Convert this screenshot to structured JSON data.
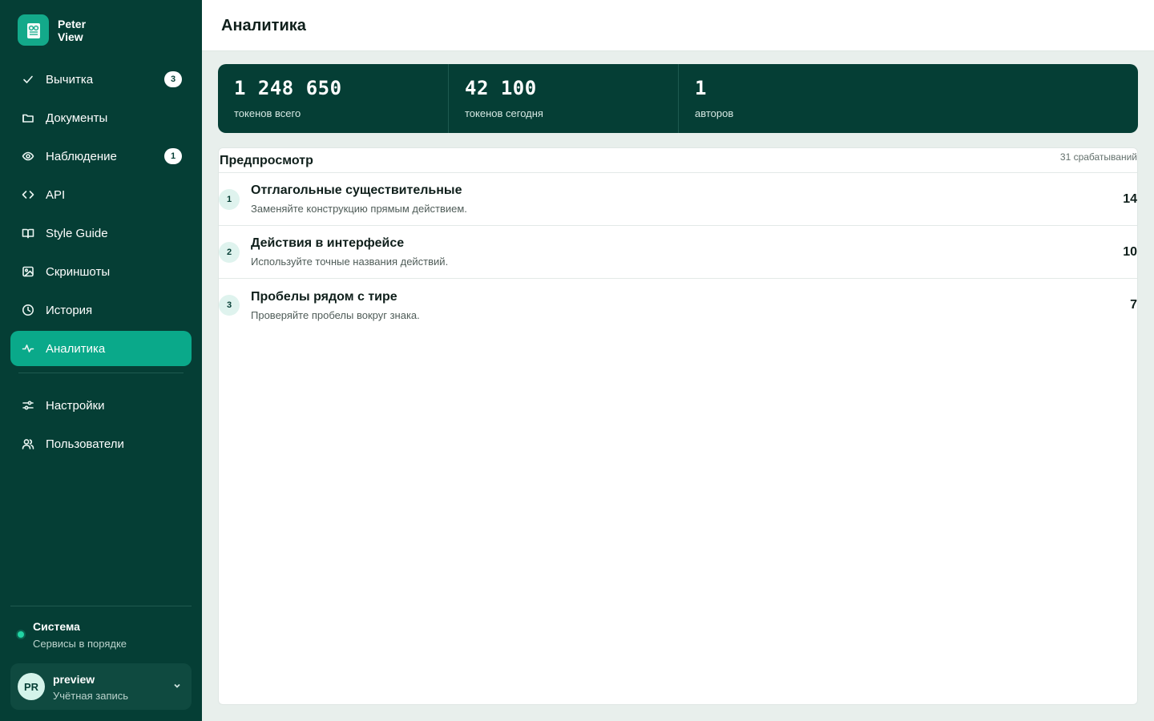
{
  "brand": {
    "line1": "Peter",
    "line2": "View",
    "icon": "book-reader-icon"
  },
  "sidebar": {
    "items": [
      {
        "label": "Вычитка",
        "icon": "check-icon",
        "badge": "3"
      },
      {
        "label": "Документы",
        "icon": "folder-icon"
      },
      {
        "label": "Наблюдение",
        "icon": "eye-icon",
        "badge": "1"
      },
      {
        "label": "API",
        "icon": "code-icon"
      },
      {
        "label": "Style Guide",
        "icon": "book-icon"
      },
      {
        "label": "Скриншоты",
        "icon": "image-icon"
      },
      {
        "label": "История",
        "icon": "clock-icon"
      },
      {
        "label": "Аналитика",
        "icon": "activity-icon",
        "active": true
      }
    ],
    "secondary": [
      {
        "label": "Настройки",
        "icon": "sliders-icon"
      },
      {
        "label": "Пользователи",
        "icon": "users-icon"
      }
    ]
  },
  "system": {
    "title": "Система",
    "status": "Сервисы в порядке",
    "status_color": "#21d4a4"
  },
  "account": {
    "initials": "PR",
    "name": "preview",
    "sub": "Учётная запись"
  },
  "header": {
    "title": "Аналитика"
  },
  "stats": [
    {
      "value": "1 248 650",
      "label": "токенов всего"
    },
    {
      "value": "42 100",
      "label": "токенов сегодня"
    },
    {
      "value": "1",
      "label": "авторов"
    }
  ],
  "preview": {
    "title": "Предпросмотр",
    "meta": "31 срабатываний",
    "rows": [
      {
        "rank": "1",
        "title": "Отглагольные существительные",
        "sub": "Заменяйте конструкцию прямым действием.",
        "count": "14"
      },
      {
        "rank": "2",
        "title": "Действия в интерфейсе",
        "sub": "Используйте точные названия действий.",
        "count": "10"
      },
      {
        "rank": "3",
        "title": "Пробелы рядом с тире",
        "sub": "Проверяйте пробелы вокруг знака.",
        "count": "7"
      }
    ]
  },
  "colors": {
    "sidebar_bg": "#053e35",
    "accent": "#0aa98a",
    "page_bg": "#e8efec"
  }
}
